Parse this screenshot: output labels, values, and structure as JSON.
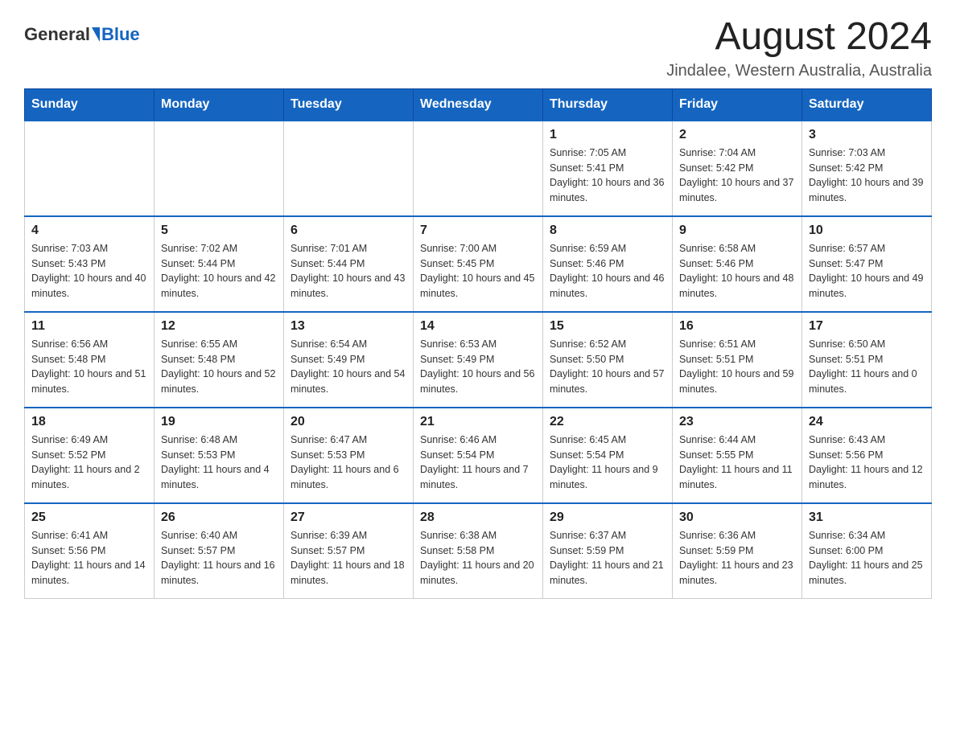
{
  "header": {
    "logo_general": "General",
    "logo_blue": "Blue",
    "title": "August 2024",
    "subtitle": "Jindalee, Western Australia, Australia"
  },
  "calendar": {
    "weekdays": [
      "Sunday",
      "Monday",
      "Tuesday",
      "Wednesday",
      "Thursday",
      "Friday",
      "Saturday"
    ],
    "rows": [
      [
        {
          "day": "",
          "info": ""
        },
        {
          "day": "",
          "info": ""
        },
        {
          "day": "",
          "info": ""
        },
        {
          "day": "",
          "info": ""
        },
        {
          "day": "1",
          "info": "Sunrise: 7:05 AM\nSunset: 5:41 PM\nDaylight: 10 hours and 36 minutes."
        },
        {
          "day": "2",
          "info": "Sunrise: 7:04 AM\nSunset: 5:42 PM\nDaylight: 10 hours and 37 minutes."
        },
        {
          "day": "3",
          "info": "Sunrise: 7:03 AM\nSunset: 5:42 PM\nDaylight: 10 hours and 39 minutes."
        }
      ],
      [
        {
          "day": "4",
          "info": "Sunrise: 7:03 AM\nSunset: 5:43 PM\nDaylight: 10 hours and 40 minutes."
        },
        {
          "day": "5",
          "info": "Sunrise: 7:02 AM\nSunset: 5:44 PM\nDaylight: 10 hours and 42 minutes."
        },
        {
          "day": "6",
          "info": "Sunrise: 7:01 AM\nSunset: 5:44 PM\nDaylight: 10 hours and 43 minutes."
        },
        {
          "day": "7",
          "info": "Sunrise: 7:00 AM\nSunset: 5:45 PM\nDaylight: 10 hours and 45 minutes."
        },
        {
          "day": "8",
          "info": "Sunrise: 6:59 AM\nSunset: 5:46 PM\nDaylight: 10 hours and 46 minutes."
        },
        {
          "day": "9",
          "info": "Sunrise: 6:58 AM\nSunset: 5:46 PM\nDaylight: 10 hours and 48 minutes."
        },
        {
          "day": "10",
          "info": "Sunrise: 6:57 AM\nSunset: 5:47 PM\nDaylight: 10 hours and 49 minutes."
        }
      ],
      [
        {
          "day": "11",
          "info": "Sunrise: 6:56 AM\nSunset: 5:48 PM\nDaylight: 10 hours and 51 minutes."
        },
        {
          "day": "12",
          "info": "Sunrise: 6:55 AM\nSunset: 5:48 PM\nDaylight: 10 hours and 52 minutes."
        },
        {
          "day": "13",
          "info": "Sunrise: 6:54 AM\nSunset: 5:49 PM\nDaylight: 10 hours and 54 minutes."
        },
        {
          "day": "14",
          "info": "Sunrise: 6:53 AM\nSunset: 5:49 PM\nDaylight: 10 hours and 56 minutes."
        },
        {
          "day": "15",
          "info": "Sunrise: 6:52 AM\nSunset: 5:50 PM\nDaylight: 10 hours and 57 minutes."
        },
        {
          "day": "16",
          "info": "Sunrise: 6:51 AM\nSunset: 5:51 PM\nDaylight: 10 hours and 59 minutes."
        },
        {
          "day": "17",
          "info": "Sunrise: 6:50 AM\nSunset: 5:51 PM\nDaylight: 11 hours and 0 minutes."
        }
      ],
      [
        {
          "day": "18",
          "info": "Sunrise: 6:49 AM\nSunset: 5:52 PM\nDaylight: 11 hours and 2 minutes."
        },
        {
          "day": "19",
          "info": "Sunrise: 6:48 AM\nSunset: 5:53 PM\nDaylight: 11 hours and 4 minutes."
        },
        {
          "day": "20",
          "info": "Sunrise: 6:47 AM\nSunset: 5:53 PM\nDaylight: 11 hours and 6 minutes."
        },
        {
          "day": "21",
          "info": "Sunrise: 6:46 AM\nSunset: 5:54 PM\nDaylight: 11 hours and 7 minutes."
        },
        {
          "day": "22",
          "info": "Sunrise: 6:45 AM\nSunset: 5:54 PM\nDaylight: 11 hours and 9 minutes."
        },
        {
          "day": "23",
          "info": "Sunrise: 6:44 AM\nSunset: 5:55 PM\nDaylight: 11 hours and 11 minutes."
        },
        {
          "day": "24",
          "info": "Sunrise: 6:43 AM\nSunset: 5:56 PM\nDaylight: 11 hours and 12 minutes."
        }
      ],
      [
        {
          "day": "25",
          "info": "Sunrise: 6:41 AM\nSunset: 5:56 PM\nDaylight: 11 hours and 14 minutes."
        },
        {
          "day": "26",
          "info": "Sunrise: 6:40 AM\nSunset: 5:57 PM\nDaylight: 11 hours and 16 minutes."
        },
        {
          "day": "27",
          "info": "Sunrise: 6:39 AM\nSunset: 5:57 PM\nDaylight: 11 hours and 18 minutes."
        },
        {
          "day": "28",
          "info": "Sunrise: 6:38 AM\nSunset: 5:58 PM\nDaylight: 11 hours and 20 minutes."
        },
        {
          "day": "29",
          "info": "Sunrise: 6:37 AM\nSunset: 5:59 PM\nDaylight: 11 hours and 21 minutes."
        },
        {
          "day": "30",
          "info": "Sunrise: 6:36 AM\nSunset: 5:59 PM\nDaylight: 11 hours and 23 minutes."
        },
        {
          "day": "31",
          "info": "Sunrise: 6:34 AM\nSunset: 6:00 PM\nDaylight: 11 hours and 25 minutes."
        }
      ]
    ]
  }
}
